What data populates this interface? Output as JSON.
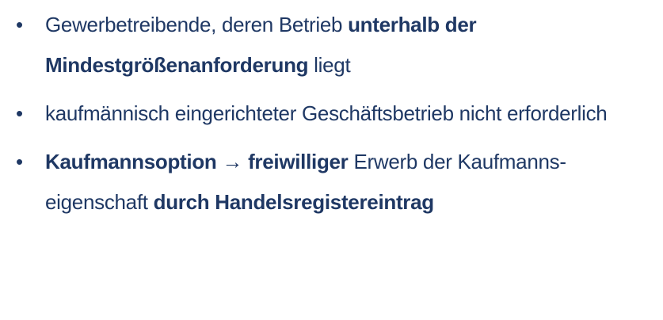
{
  "bullets": [
    {
      "segments": [
        {
          "text": "Gewerbetreibende, deren Betrieb ",
          "bold": false
        },
        {
          "text": "unterhalb der Mindestgrößenanforderung",
          "bold": true
        },
        {
          "text": " liegt",
          "bold": false
        }
      ]
    },
    {
      "segments": [
        {
          "text": "kaufmännisch eingerichteter Geschäftsbetrieb nicht erforderlich",
          "bold": false
        }
      ]
    },
    {
      "segments": [
        {
          "text": "Kaufmannsoption",
          "bold": true
        },
        {
          "text": " → ",
          "bold": false
        },
        {
          "text": "freiwilliger",
          "bold": true
        },
        {
          "text": " Erwerb der Kaufmanns-eigenschaft ",
          "bold": false
        },
        {
          "text": "durch Handelsregistereintrag",
          "bold": true
        }
      ]
    }
  ],
  "bullet_glyph": "•",
  "colors": {
    "text": "#1f3864",
    "background": "#ffffff"
  }
}
